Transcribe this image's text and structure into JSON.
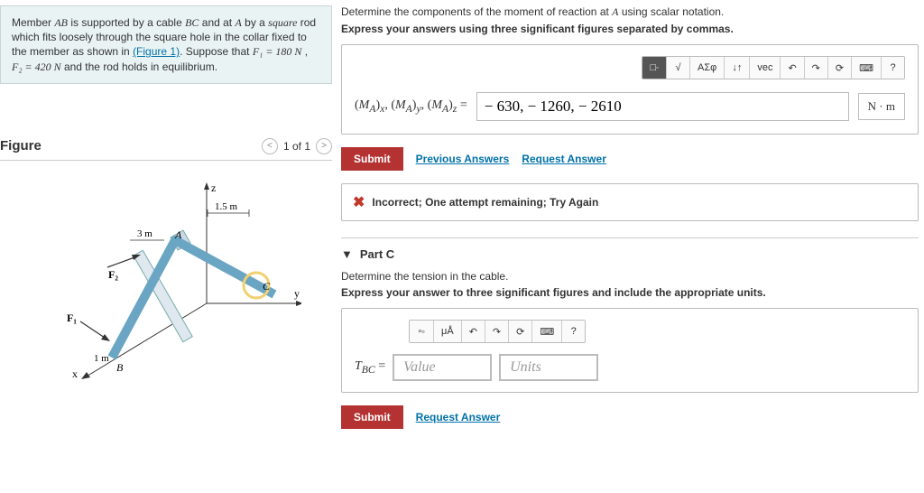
{
  "problem": {
    "text1": "Member ",
    "ABit": "AB",
    "text2": " is supported by a cable ",
    "BCit": "BC",
    "text3": " and at ",
    "Ait": "A",
    "text4": " by a ",
    "sqit": "square",
    "text5": " rod which fits loosely through the square hole in the collar fixed to the member as shown in ",
    "figlink": "(Figure 1)",
    "text6": ". Suppose that ",
    "F1eq": "F₁ = 180  N",
    "text7": " , ",
    "F2eq": "F₂ = 420  N",
    "text8": " and the rod holds in equilibrium."
  },
  "figure": {
    "title": "Figure",
    "page": "1 of 1",
    "z": "z",
    "y": "y",
    "x": "x",
    "len15": "1.5 m",
    "len3": "3 m",
    "len1": "1 m",
    "A": "A",
    "B": "B",
    "C": "C",
    "F1": "F₁",
    "F2": "F₂"
  },
  "partB": {
    "line1": "Determine the components of the moment of reaction at ",
    "Ait": "A",
    "line1b": " using scalar notation.",
    "line2": "Express your answers using three significant figures separated by commas.",
    "tb": {
      "sqrt": "√",
      "asf": "ΑΣφ",
      "updown": "↓↑",
      "vec": "vec",
      "undo": "↶",
      "redo": "↷",
      "reset": "⟳",
      "kbd": "⌨",
      "help": "?"
    },
    "labels": "(Mᴀ)ₓ, (Mᴀ)ᵧ, (Mᴀ)𝓏 =",
    "answer_value": "− 630, − 1260, − 2610",
    "unit": "N · m",
    "submit": "Submit",
    "prev": "Previous Answers",
    "req": "Request Answer",
    "feedback": "Incorrect; One attempt remaining; Try Again"
  },
  "partC": {
    "title": "Part C",
    "line1": "Determine the tension in the cable.",
    "line2": "Express your answer to three significant figures and include the appropriate units.",
    "tb": {
      "t1": "▫",
      "t2": "μÅ",
      "undo": "↶",
      "redo": "↷",
      "reset": "⟳",
      "kbd": "⌨",
      "help": "?"
    },
    "label": "T_BC =",
    "value_ph": "Value",
    "units_ph": "Units",
    "submit": "Submit",
    "req": "Request Answer"
  }
}
